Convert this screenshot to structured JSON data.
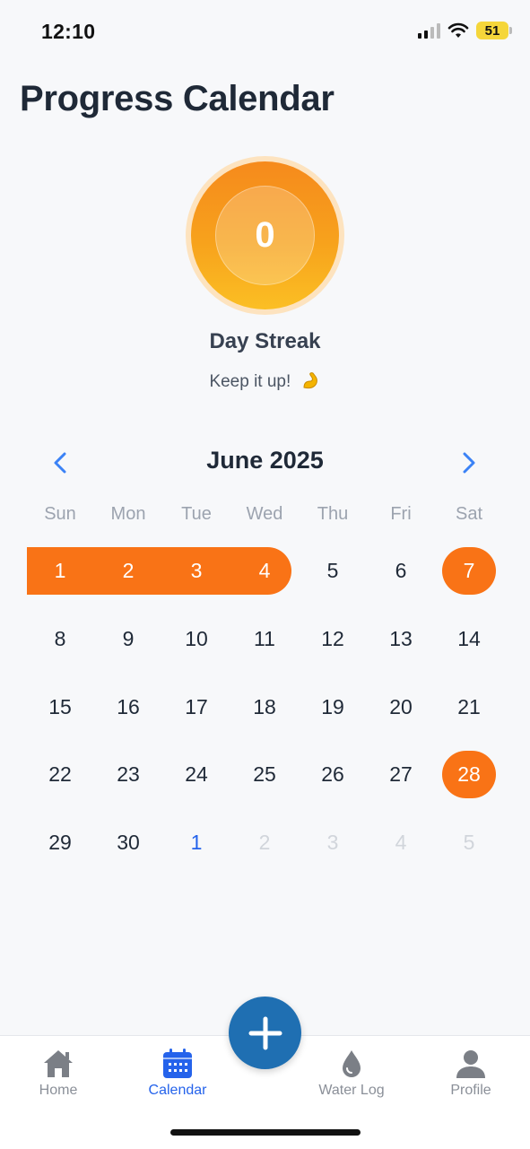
{
  "status": {
    "time": "12:10",
    "battery": "51"
  },
  "page": {
    "title": "Progress Calendar"
  },
  "streak": {
    "count": "0",
    "label": "Day Streak",
    "subtitle": "Keep it up!",
    "emoji_icon": "flexed-biceps-icon"
  },
  "calendar": {
    "month_title": "June 2025",
    "weekdays": [
      "Sun",
      "Mon",
      "Tue",
      "Wed",
      "Thu",
      "Fri",
      "Sat"
    ],
    "weeks": [
      [
        "1",
        "2",
        "3",
        "4",
        "5",
        "6",
        "7"
      ],
      [
        "8",
        "9",
        "10",
        "11",
        "12",
        "13",
        "14"
      ],
      [
        "15",
        "16",
        "17",
        "18",
        "19",
        "20",
        "21"
      ],
      [
        "22",
        "23",
        "24",
        "25",
        "26",
        "27",
        "28"
      ],
      [
        "29",
        "30",
        "1",
        "2",
        "3",
        "4",
        "5"
      ]
    ],
    "streak_days": [
      "1",
      "2",
      "3",
      "4"
    ],
    "completed_days": [
      "7",
      "28"
    ],
    "today_next_month": "1",
    "colors": {
      "accent": "#f97316",
      "today": "#2563eb",
      "muted": "#d1d5db"
    }
  },
  "tabs": [
    {
      "label": "Home",
      "icon": "home-icon",
      "active": false
    },
    {
      "label": "Calendar",
      "icon": "calendar-icon",
      "active": true
    },
    {
      "label": "Water Log",
      "icon": "water-drop-icon",
      "active": false
    },
    {
      "label": "Profile",
      "icon": "profile-icon",
      "active": false
    }
  ],
  "fab": {
    "icon": "plus-icon",
    "color": "#1f6fb2"
  }
}
